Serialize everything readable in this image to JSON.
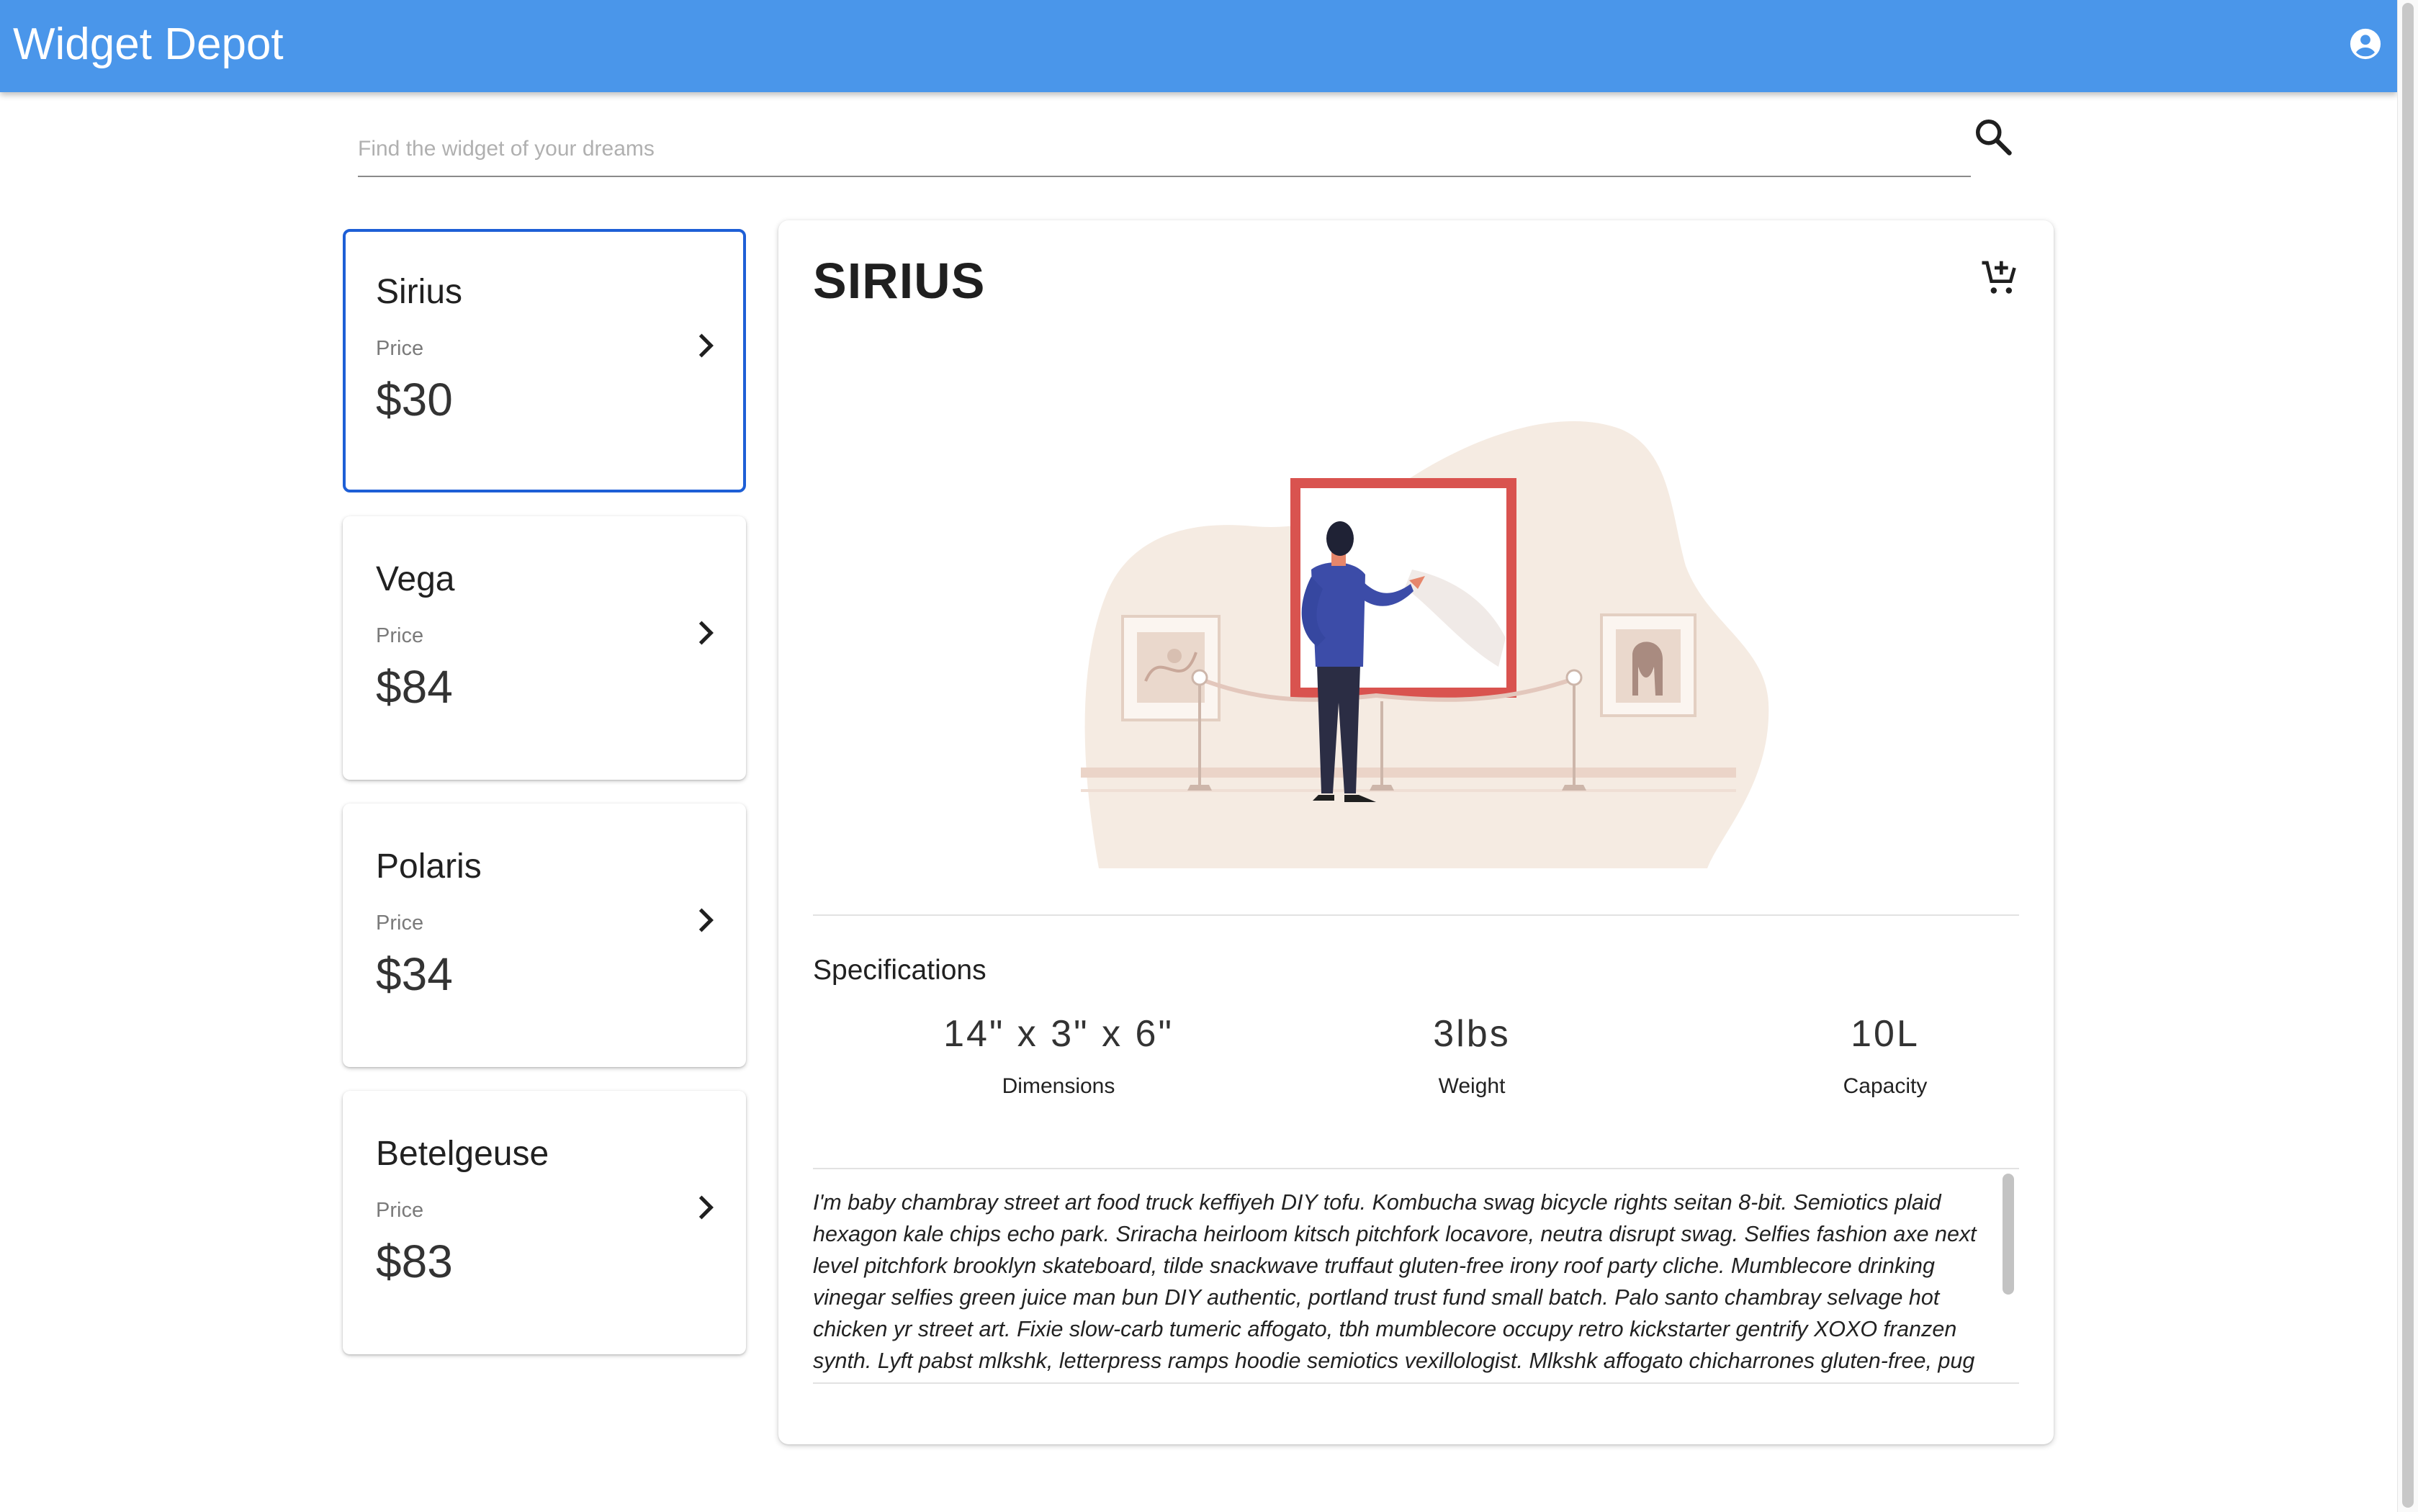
{
  "app": {
    "title": "Widget Depot",
    "account_icon": "account-circle-icon",
    "brand_color": "#4a96ea"
  },
  "search": {
    "placeholder": "Find the widget of your dreams",
    "value": "",
    "icon": "search-icon"
  },
  "products": [
    {
      "name": "Sirius",
      "price_label": "Price",
      "price": "$30",
      "selected": true
    },
    {
      "name": "Vega",
      "price_label": "Price",
      "price": "$84",
      "selected": false
    },
    {
      "name": "Polaris",
      "price_label": "Price",
      "price": "$34",
      "selected": false
    },
    {
      "name": "Betelgeuse",
      "price_label": "Price",
      "price": "$83",
      "selected": false
    }
  ],
  "detail": {
    "title": "SIRIUS",
    "cart_icon": "add-to-cart-icon",
    "image": "art-gallery-illustration",
    "specifications_heading": "Specifications",
    "specs": [
      {
        "value": "14\" x 3\" x 6\"",
        "label": "Dimensions"
      },
      {
        "value": "3lbs",
        "label": "Weight"
      },
      {
        "value": "10L",
        "label": "Capacity"
      }
    ],
    "description": "I'm baby chambray street art food truck keffiyeh DIY tofu. Kombucha swag bicycle rights seitan 8-bit. Semiotics plaid hexagon kale chips echo park. Sriracha heirloom kitsch pitchfork locavore, neutra disrupt swag. Selfies fashion axe next level pitchfork brooklyn skateboard, tilde snackwave truffaut gluten-free irony roof party cliche. Mumblecore drinking vinegar selfies green juice man bun DIY authentic, portland trust fund small batch. Palo santo chambray selvage hot chicken yr street art. Fixie slow-carb tumeric affogato, tbh mumblecore occupy retro kickstarter gentrify XOXO franzen synth. Lyft pabst mlkshk, letterpress ramps hoodie semiotics vexillologist. Mlkshk affogato chicharrones gluten-free, pug raclette prism. Palo santo"
  },
  "colors": {
    "selected_border": "#1e5fd6",
    "illustration_blob": "#f5ebe2",
    "frame_red": "#d9534f"
  }
}
